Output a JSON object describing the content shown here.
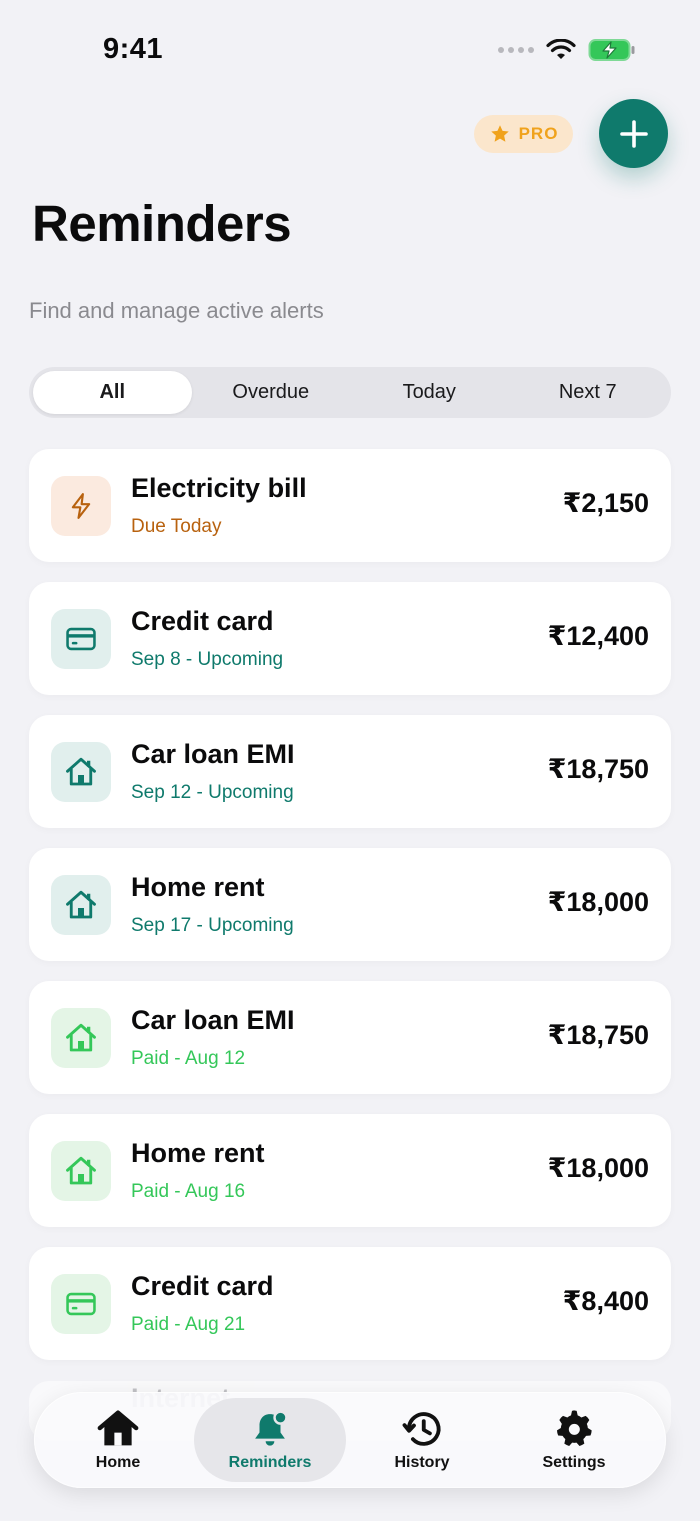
{
  "status_bar": {
    "time": "9:41"
  },
  "header": {
    "pro_label": "PRO",
    "title": "Reminders",
    "subtitle": "Find and manage active alerts"
  },
  "filters": {
    "tabs": [
      "All",
      "Overdue",
      "Today",
      "Next 7"
    ],
    "selected": "All"
  },
  "reminders": [
    {
      "title": "Electricity bill",
      "status": "Due Today",
      "amount": "₹2,150",
      "icon": "lightning-icon",
      "tone": "orange"
    },
    {
      "title": "Credit card",
      "status": "Sep 8 - Upcoming",
      "amount": "₹12,400",
      "icon": "credit-card-icon",
      "tone": "teal"
    },
    {
      "title": "Car loan EMI",
      "status": "Sep 12 - Upcoming",
      "amount": "₹18,750",
      "icon": "house-icon",
      "tone": "teal"
    },
    {
      "title": "Home rent",
      "status": "Sep 17 - Upcoming",
      "amount": "₹18,000",
      "icon": "house-icon",
      "tone": "teal"
    },
    {
      "title": "Car loan EMI",
      "status": "Paid - Aug 12",
      "amount": "₹18,750",
      "icon": "house-icon",
      "tone": "green"
    },
    {
      "title": "Home rent",
      "status": "Paid - Aug 16",
      "amount": "₹18,000",
      "icon": "house-icon",
      "tone": "green"
    },
    {
      "title": "Credit card",
      "status": "Paid - Aug 21",
      "amount": "₹8,400",
      "icon": "credit-card-icon",
      "tone": "green"
    }
  ],
  "partial_item": {
    "title": "Internet"
  },
  "tab_bar": {
    "items": [
      {
        "label": "Home",
        "icon": "home-icon"
      },
      {
        "label": "Reminders",
        "icon": "bell-icon"
      },
      {
        "label": "History",
        "icon": "history-icon"
      },
      {
        "label": "Settings",
        "icon": "gear-icon"
      }
    ],
    "active": "Reminders"
  },
  "colors": {
    "accent": "#0f7a6c",
    "due_today": "#b8620f",
    "upcoming": "#0f7a6c",
    "paid": "#34c759",
    "pro": "#f0a21c"
  }
}
